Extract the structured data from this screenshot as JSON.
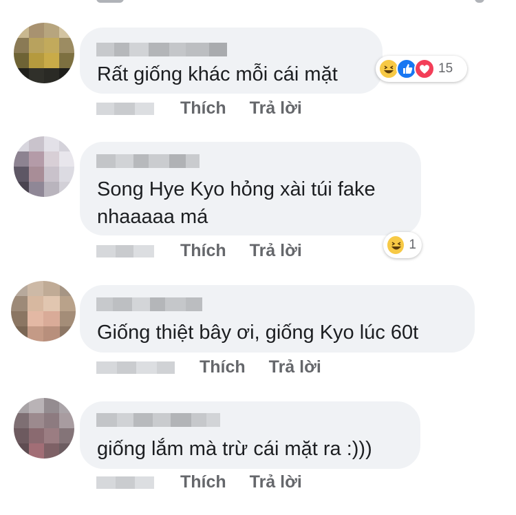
{
  "comments": [
    {
      "text_lines": [
        "Rất giống khác mỗi cái mặt"
      ],
      "like_label": "Thích",
      "reply_label": "Trả lời",
      "reactions": {
        "types": [
          "haha-icon",
          "like-icon",
          "love-icon"
        ],
        "count": "15"
      }
    },
    {
      "text_lines": [
        "Song Hye Kyo hỏng xài túi fake",
        "nhaaaaa má"
      ],
      "like_label": "Thích",
      "reply_label": "Trả lời",
      "reactions": {
        "types": [
          "haha-icon"
        ],
        "count": "1"
      }
    },
    {
      "text_lines": [
        "Giống thiệt bây ơi, giống Kyo lúc 60t"
      ],
      "like_label": "Thích",
      "reply_label": "Trả lời"
    },
    {
      "text_lines": [
        "giống lắm mà trừ cái mặt ra :)))"
      ],
      "like_label": "Thích",
      "reply_label": "Trả lời"
    }
  ],
  "colors": {
    "bubble": "#f0f2f5",
    "action_text": "#65676b",
    "like_reaction": "#1877f2",
    "love_reaction": "#f33e58",
    "haha_reaction": "#f7c945"
  }
}
